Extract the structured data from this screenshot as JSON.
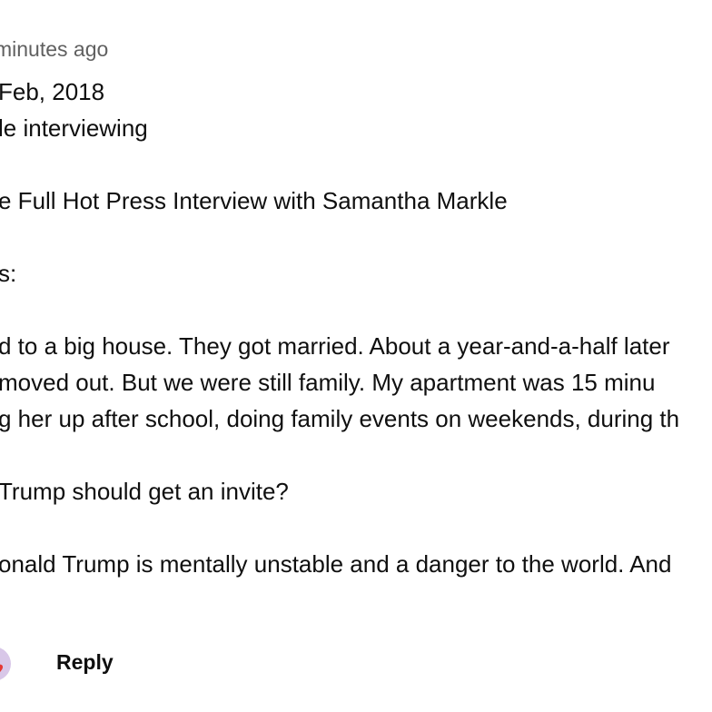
{
  "comment": {
    "timestamp": "minutes ago",
    "lines": [
      "Feb, 2018",
      "le interviewing",
      "",
      "e Full Hot Press Interview with Samantha Markle",
      "",
      "s:",
      "",
      "d to a big house. They got married. About a year-and-a-half later",
      " moved out. But we were still family. My apartment was 15 minu",
      "g her up after school, doing family events on weekends, during th",
      "",
      " Trump should get an invite?",
      "",
      "onald Trump is mentally unstable and a danger to the world. And"
    ],
    "reply_label": "Reply"
  },
  "icons": {
    "avatar_badge": "heart-icon"
  },
  "colors": {
    "text": "#0f0f0f",
    "secondary_text": "#606060",
    "heart": "#e53935",
    "avatar_bg": "#d8c7e8"
  }
}
